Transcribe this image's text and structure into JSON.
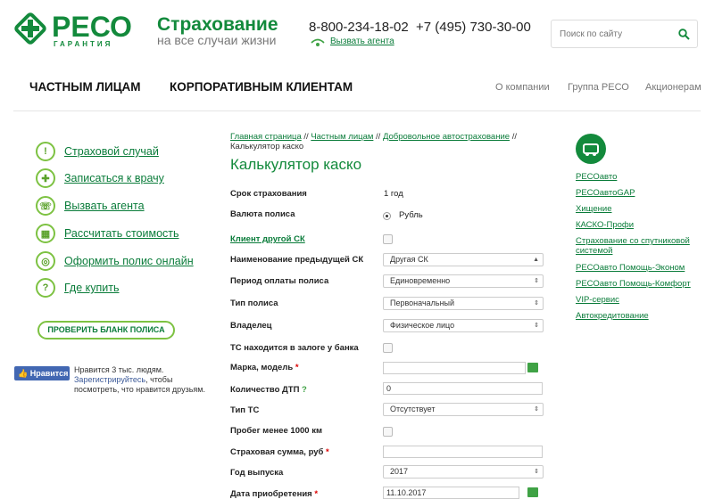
{
  "header": {
    "logo_text": "РЕСО",
    "logo_sub": "ГАРАНТИЯ",
    "tagline_title": "Страхование",
    "tagline_sub": "на все случаи жизни",
    "phone1": "8-800-234-18-02",
    "phone2": "+7 (495) 730-30-00",
    "call_agent": "Вызвать агента",
    "search_placeholder": "Поиск по сайту"
  },
  "nav": {
    "private": "ЧАСТНЫМ ЛИЦАМ",
    "corporate": "КОРПОРАТИВНЫМ КЛИЕНТАМ",
    "about": "О компании",
    "group": "Группа РЕСО",
    "shareholders": "Акционерам"
  },
  "sidebar": {
    "items": [
      {
        "label": "Страховой случай",
        "icon": "exclamation-icon"
      },
      {
        "label": "Записаться к врачу",
        "icon": "medical-icon"
      },
      {
        "label": "Вызвать агента",
        "icon": "phone-icon"
      },
      {
        "label": "Рассчитать стоимость",
        "icon": "calculator-icon"
      },
      {
        "label": "Оформить полис онлайн",
        "icon": "globe-icon"
      },
      {
        "label": "Где купить",
        "icon": "question-icon"
      }
    ],
    "check_policy": "ПРОВЕРИТЬ БЛАНК ПОЛИСА",
    "fb_like": "Нравится",
    "fb_count": "Нравится 3 тыс. людям.",
    "fb_register": "Зарегистрируйтесь",
    "fb_rest": ", чтобы посмотреть, что нравится друзьям."
  },
  "breadcrumb": {
    "home": "Главная страница",
    "sep": " // ",
    "private": "Частным лицам",
    "auto": "Добровольное автострахование",
    "current": "Калькулятор каско"
  },
  "page_title": "Калькулятор каско",
  "form": {
    "term_label": "Срок страхования",
    "term_value": "1 год",
    "currency_label": "Валюта полиса",
    "currency_value": "Рубль",
    "other_client_label": "Клиент другой СК",
    "prev_insurer_label": "Наименование предыдущей СК",
    "prev_insurer_value": "Другая СК",
    "payment_period_label": "Период оплаты полиса",
    "payment_period_value": "Единовременно",
    "policy_type_label": "Тип полиса",
    "policy_type_value": "Первоначальный",
    "owner_label": "Владелец",
    "owner_value": "Физическое лицо",
    "pledged_label": "ТС находится в залоге у банка",
    "make_model_label": "Марка, модель",
    "dtp_label": "Количество ДТП",
    "dtp_value": "0",
    "vehicle_type_label": "Тип ТС",
    "vehicle_type_value": "Отсутствует",
    "mileage_label": "Пробег менее 1000 км",
    "sum_label": "Страховая сумма, руб",
    "year_label": "Год выпуска",
    "year_value": "2017",
    "purchase_label": "Дата приобретения",
    "purchase_value": "11.10.2017",
    "required_mark": "*",
    "help_mark": "?"
  },
  "right": {
    "links": [
      "РЕСОавто",
      "РЕСОавтоGAP",
      "Хищение",
      "КАСКО-Профи",
      "Страхование со спутниковой системой",
      "РЕСОавто Помощь-Эконом",
      "РЕСОавто Помощь-Комфорт",
      "VIP-сервис",
      "Автокредитование"
    ]
  },
  "colors": {
    "brand": "#138a3c",
    "accent": "#7dc242",
    "fb": "#4267b2"
  }
}
